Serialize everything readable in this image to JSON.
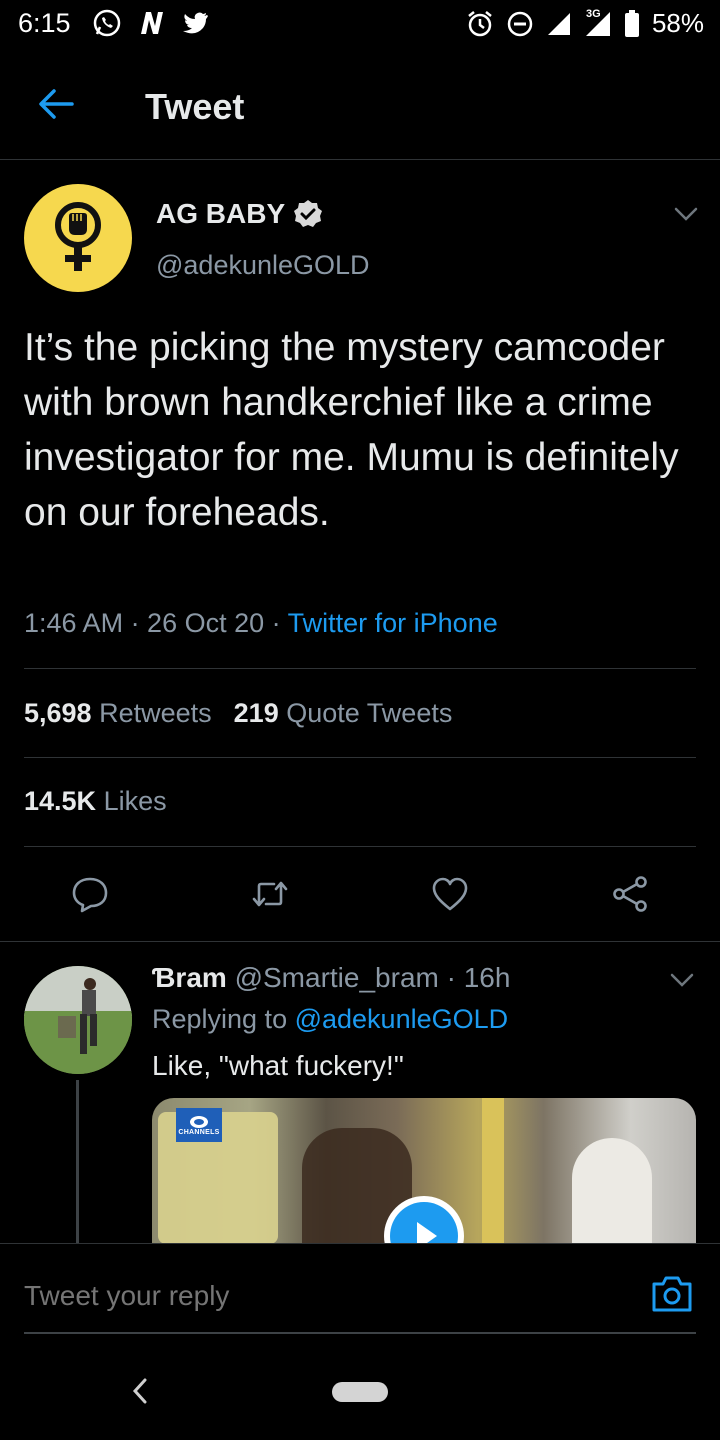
{
  "status_bar": {
    "time": "6:15",
    "left_icons": [
      "whatsapp-icon",
      "n-icon",
      "twitter-icon"
    ],
    "right_icons": [
      "alarm-icon",
      "dnd-icon",
      "signal-icon",
      "signal-3g-icon",
      "battery-icon"
    ],
    "network_label": "3G",
    "battery": "58%"
  },
  "header": {
    "title": "Tweet"
  },
  "tweet": {
    "author_name": "AG BABY",
    "author_handle": "@adekunleGOLD",
    "verified": true,
    "text": "It’s the picking the mystery camcoder with brown handkerchief like a crime investigator for me. Mumu is definitely on our foreheads.",
    "meta_time": "1:46 AM · 26 Oct 20 · ",
    "meta_source": "Twitter for iPhone",
    "retweets_count": "5,698",
    "retweets_label": "Retweets",
    "quotes_count": "219",
    "quotes_label": "Quote Tweets",
    "likes_count": "14.5K",
    "likes_label": "Likes"
  },
  "reply": {
    "name": "Ɓram",
    "handle_time": " @Smartie_bram · 16h",
    "replying_prefix": "Replying to ",
    "replying_mention": "@adekunleGOLD",
    "text": "Like, \"what fuckery!\"",
    "media_logo_text": "CHANNELS"
  },
  "composer": {
    "placeholder": "Tweet your reply"
  },
  "colors": {
    "background": "#000000",
    "accent": "#1d9bf0",
    "secondary_text": "#8b98a5",
    "avatar_bg": "#f6d84e"
  }
}
